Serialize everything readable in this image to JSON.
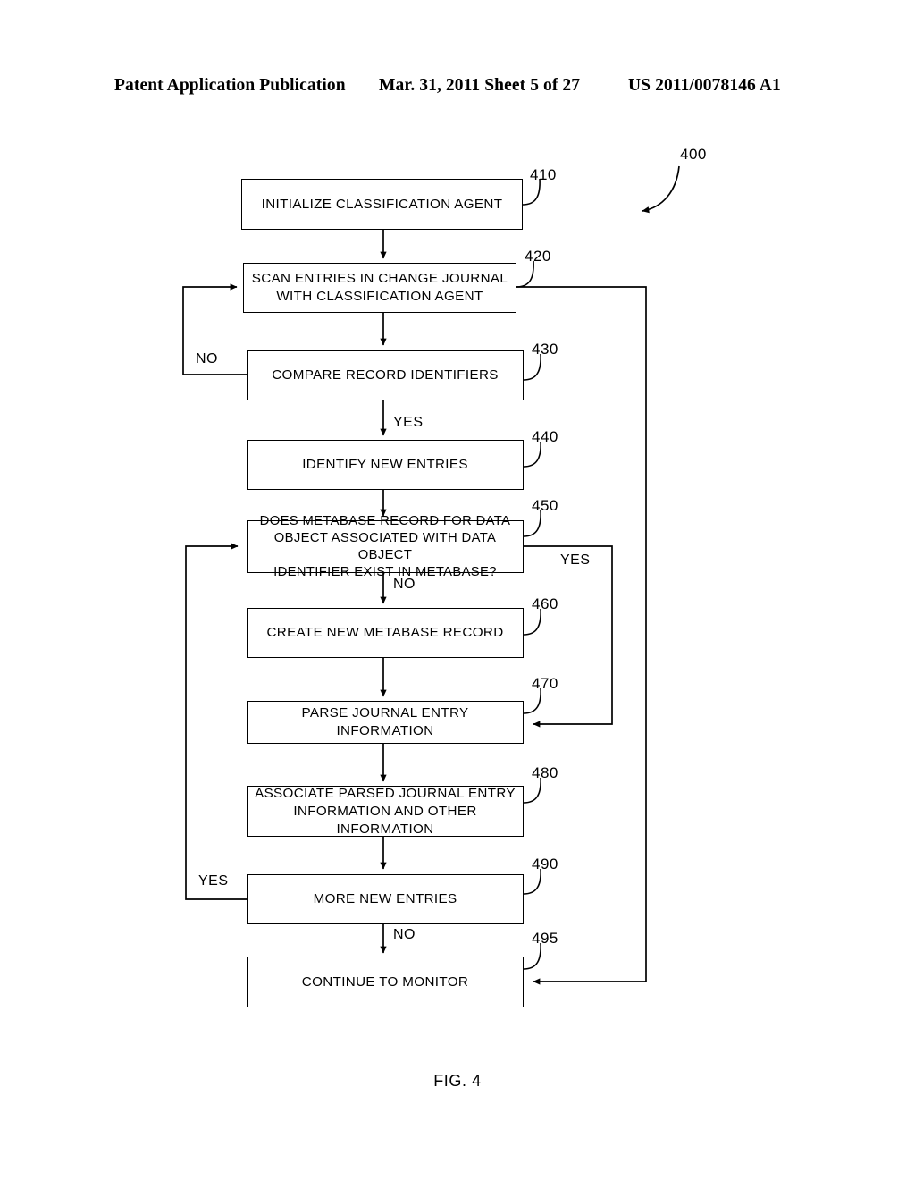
{
  "header": {
    "left": "Patent Application Publication",
    "middle": "Mar. 31, 2011  Sheet 5 of 27",
    "right": "US 2011/0078146 A1"
  },
  "figure": {
    "caption": "FIG. 4",
    "diagram_numeral": "400",
    "nodes": [
      {
        "id": "410",
        "numeral": "410",
        "label": "INITIALIZE CLASSIFICATION AGENT"
      },
      {
        "id": "420",
        "numeral": "420",
        "label": "SCAN ENTRIES IN CHANGE JOURNAL\nWITH CLASSIFICATION AGENT"
      },
      {
        "id": "430",
        "numeral": "430",
        "label": "COMPARE RECORD IDENTIFIERS"
      },
      {
        "id": "440",
        "numeral": "440",
        "label": "IDENTIFY NEW ENTRIES"
      },
      {
        "id": "450",
        "numeral": "450",
        "label": "DOES METABASE RECORD FOR DATA\nOBJECT ASSOCIATED WITH DATA OBJECT\nIDENTIFIER EXIST IN METABASE?"
      },
      {
        "id": "460",
        "numeral": "460",
        "label": "CREATE NEW METABASE RECORD"
      },
      {
        "id": "470",
        "numeral": "470",
        "label": "PARSE JOURNAL ENTRY INFORMATION"
      },
      {
        "id": "480",
        "numeral": "480",
        "label": "ASSOCIATE PARSED JOURNAL ENTRY\nINFORMATION AND OTHER INFORMATION"
      },
      {
        "id": "490",
        "numeral": "490",
        "label": "MORE NEW ENTRIES"
      },
      {
        "id": "495",
        "numeral": "495",
        "label": "CONTINUE TO MONITOR"
      }
    ],
    "edge_labels": {
      "no_430_to_420": "NO",
      "yes_430_to_440": "YES",
      "yes_450_to_470": "YES",
      "no_450_to_460": "NO",
      "yes_490_to_450": "YES",
      "no_490_to_495": "NO"
    }
  }
}
